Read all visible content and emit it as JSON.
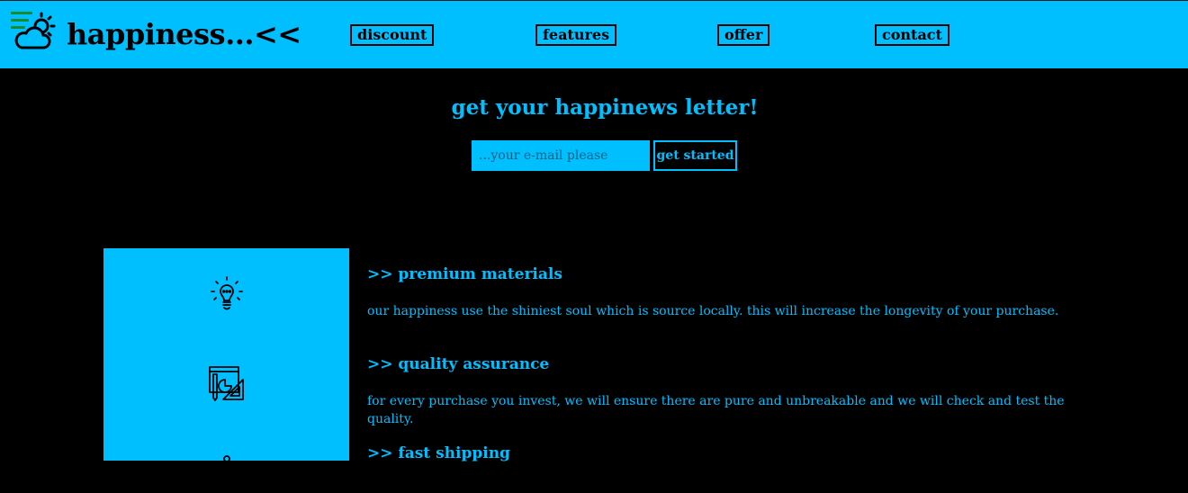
{
  "header": {
    "brand": "happiness...<<",
    "nav": [
      "discount",
      "features",
      "offer",
      "contact"
    ]
  },
  "newsletter": {
    "title": "get your happinews letter!",
    "email_placeholder": "...your e-mail please",
    "button": "get started"
  },
  "features": [
    {
      "icon": "lightbulb-icon",
      "title": ">> premium materials",
      "description": "our happiness use the shiniest soul which is source locally. this will increase the longevity of your purchase."
    },
    {
      "icon": "design-tools-icon",
      "title": ">> quality assurance",
      "description": "for every purchase you invest, we will ensure there are pure and unbreakable and we will check and test the quality."
    },
    {
      "icon": "delivery-icon",
      "title": ">> fast shipping",
      "description": ""
    }
  ],
  "colors": {
    "accent": "#00bfff",
    "background": "#000000",
    "hamburger": "#1a8a2e"
  }
}
